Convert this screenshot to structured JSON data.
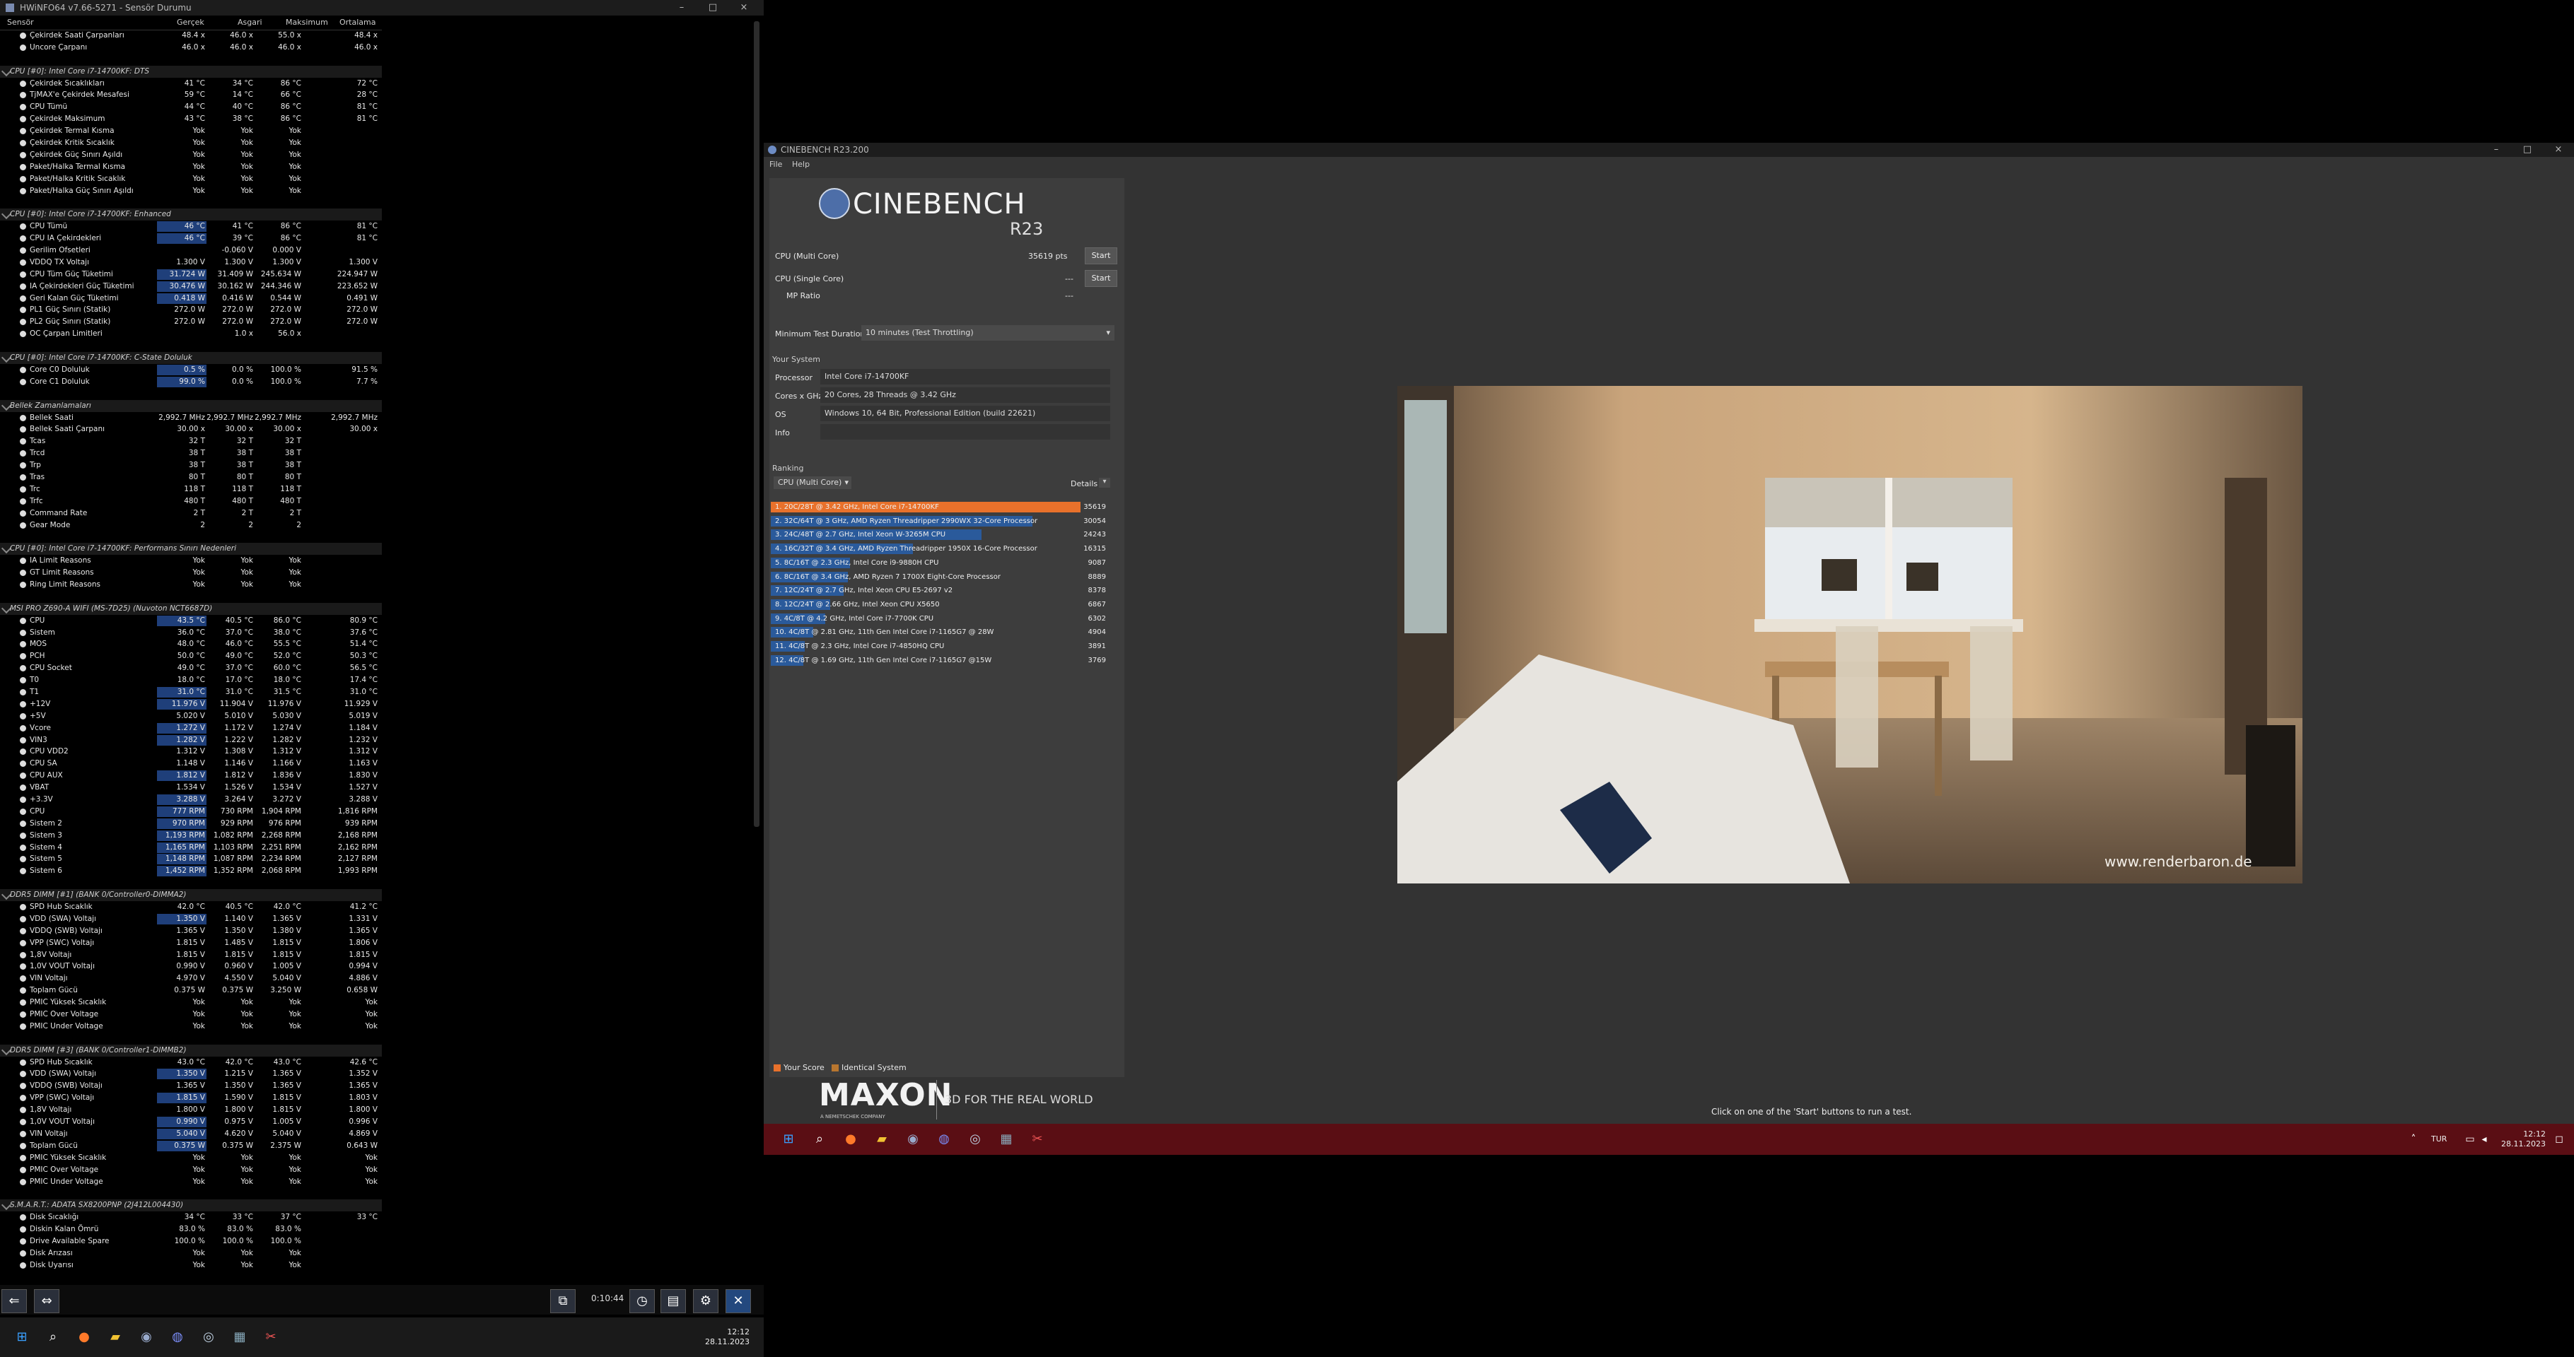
{
  "hw": {
    "title": "HWiNFO64 v7.66-5271 - Sensör Durumu",
    "columns": [
      "Sensör",
      "Gerçek",
      "Asgari",
      "Maksimum",
      "Ortalama"
    ],
    "timer": "0:10:44",
    "rows": [
      [
        "r",
        "Çekirdek Saati Çarpanları",
        "48.4 x",
        "46.0 x",
        "55.0 x",
        "48.4 x",
        ""
      ],
      [
        "r",
        "Uncore Çarpanı",
        "46.0 x",
        "46.0 x",
        "46.0 x",
        "46.0 x",
        ""
      ],
      [
        "b",
        "",
        "",
        "",
        "",
        "",
        ""
      ],
      [
        "g",
        "CPU [#0]: Intel Core i7-14700KF: DTS",
        "",
        "",
        "",
        "",
        ""
      ],
      [
        "r",
        "Çekirdek Sıcaklıkları",
        "41 °C",
        "34 °C",
        "86 °C",
        "72 °C",
        ""
      ],
      [
        "r",
        "TjMAX'e Çekirdek Mesafesi",
        "59 °C",
        "14 °C",
        "66 °C",
        "28 °C",
        ""
      ],
      [
        "r",
        "CPU Tümü",
        "44 °C",
        "40 °C",
        "86 °C",
        "81 °C",
        ""
      ],
      [
        "r",
        "Çekirdek Maksimum",
        "43 °C",
        "38 °C",
        "86 °C",
        "81 °C",
        ""
      ],
      [
        "r",
        "Çekirdek Termal Kısma",
        "Yok",
        "Yok",
        "Yok",
        "",
        ""
      ],
      [
        "r",
        "Çekirdek Kritik Sıcaklık",
        "Yok",
        "Yok",
        "Yok",
        "",
        ""
      ],
      [
        "r",
        "Çekirdek Güç Sınırı Aşıldı",
        "Yok",
        "Yok",
        "Yok",
        "",
        ""
      ],
      [
        "r",
        "Paket/Halka Termal Kısma",
        "Yok",
        "Yok",
        "Yok",
        "",
        ""
      ],
      [
        "r",
        "Paket/Halka Kritik Sıcaklık",
        "Yok",
        "Yok",
        "Yok",
        "",
        ""
      ],
      [
        "r",
        "Paket/Halka Güç Sınırı Aşıldı",
        "Yok",
        "Yok",
        "Yok",
        "",
        ""
      ],
      [
        "b",
        "",
        "",
        "",
        "",
        "",
        ""
      ],
      [
        "g",
        "CPU [#0]: Intel Core i7-14700KF: Enhanced",
        "",
        "",
        "",
        "",
        ""
      ],
      [
        "r",
        "CPU Tümü",
        "46 °C",
        "41 °C",
        "86 °C",
        "81 °C",
        "h"
      ],
      [
        "r",
        "CPU IA Çekirdekleri",
        "46 °C",
        "39 °C",
        "86 °C",
        "81 °C",
        "h"
      ],
      [
        "r",
        "Gerilim Ofsetleri",
        "",
        "-0.060 V",
        "0.000 V",
        "",
        ""
      ],
      [
        "r",
        "VDDQ TX Voltajı",
        "1.300 V",
        "1.300 V",
        "1.300 V",
        "1.300 V",
        ""
      ],
      [
        "r",
        "CPU Tüm Güç Tüketimi",
        "31.724 W",
        "31.409 W",
        "245.634 W",
        "224.947 W",
        "h"
      ],
      [
        "r",
        "IA Çekirdekleri Güç Tüketimi",
        "30.476 W",
        "30.162 W",
        "244.346 W",
        "223.652 W",
        "h"
      ],
      [
        "r",
        "Geri Kalan Güç Tüketimi",
        "0.418 W",
        "0.416 W",
        "0.544 W",
        "0.491 W",
        "h"
      ],
      [
        "r",
        "PL1 Güç Sınırı (Statik)",
        "272.0 W",
        "272.0 W",
        "272.0 W",
        "272.0 W",
        ""
      ],
      [
        "r",
        "PL2 Güç Sınırı (Statik)",
        "272.0 W",
        "272.0 W",
        "272.0 W",
        "272.0 W",
        ""
      ],
      [
        "r",
        "OC Çarpan Limitleri",
        "",
        "1.0 x",
        "56.0 x",
        "",
        ""
      ],
      [
        "b",
        "",
        "",
        "",
        "",
        "",
        ""
      ],
      [
        "g",
        "CPU [#0]: Intel Core i7-14700KF: C-State Doluluk",
        "",
        "",
        "",
        "",
        ""
      ],
      [
        "r",
        "Core C0 Doluluk",
        "0.5 %",
        "0.0 %",
        "100.0 %",
        "91.5 %",
        "h"
      ],
      [
        "r",
        "Core C1 Doluluk",
        "99.0 %",
        "0.0 %",
        "100.0 %",
        "7.7 %",
        "h"
      ],
      [
        "b",
        "",
        "",
        "",
        "",
        "",
        ""
      ],
      [
        "g",
        "Bellek Zamanlamaları",
        "",
        "",
        "",
        "",
        ""
      ],
      [
        "r",
        "Bellek Saati",
        "2,992.7 MHz",
        "2,992.7 MHz",
        "2,992.7 MHz",
        "2,992.7 MHz",
        ""
      ],
      [
        "r",
        "Bellek Saati Çarpanı",
        "30.00 x",
        "30.00 x",
        "30.00 x",
        "30.00 x",
        ""
      ],
      [
        "r",
        "Tcas",
        "32 T",
        "32 T",
        "32 T",
        "",
        ""
      ],
      [
        "r",
        "Trcd",
        "38 T",
        "38 T",
        "38 T",
        "",
        ""
      ],
      [
        "r",
        "Trp",
        "38 T",
        "38 T",
        "38 T",
        "",
        ""
      ],
      [
        "r",
        "Tras",
        "80 T",
        "80 T",
        "80 T",
        "",
        ""
      ],
      [
        "r",
        "Trc",
        "118 T",
        "118 T",
        "118 T",
        "",
        ""
      ],
      [
        "r",
        "Trfc",
        "480 T",
        "480 T",
        "480 T",
        "",
        ""
      ],
      [
        "r",
        "Command Rate",
        "2 T",
        "2 T",
        "2 T",
        "",
        ""
      ],
      [
        "r",
        "Gear Mode",
        "2",
        "2",
        "2",
        "",
        ""
      ],
      [
        "b",
        "",
        "",
        "",
        "",
        "",
        ""
      ],
      [
        "g",
        "CPU [#0]: Intel Core i7-14700KF: Performans Sınırı Nedenleri",
        "",
        "",
        "",
        "",
        ""
      ],
      [
        "r",
        "IA Limit Reasons",
        "Yok",
        "Yok",
        "Yok",
        "",
        ""
      ],
      [
        "r",
        "GT Limit Reasons",
        "Yok",
        "Yok",
        "Yok",
        "",
        ""
      ],
      [
        "r",
        "Ring Limit Reasons",
        "Yok",
        "Yok",
        "Yok",
        "",
        ""
      ],
      [
        "b",
        "",
        "",
        "",
        "",
        "",
        ""
      ],
      [
        "g",
        "MSI PRO Z690-A WIFI (MS-7D25) (Nuvoton NCT6687D)",
        "",
        "",
        "",
        "",
        ""
      ],
      [
        "r",
        "CPU",
        "43.5 °C",
        "40.5 °C",
        "86.0 °C",
        "80.9 °C",
        "h"
      ],
      [
        "r",
        "Sistem",
        "36.0 °C",
        "37.0 °C",
        "38.0 °C",
        "37.6 °C",
        ""
      ],
      [
        "r",
        "MOS",
        "48.0 °C",
        "46.0 °C",
        "55.5 °C",
        "51.4 °C",
        ""
      ],
      [
        "r",
        "PCH",
        "50.0 °C",
        "49.0 °C",
        "52.0 °C",
        "50.3 °C",
        ""
      ],
      [
        "r",
        "CPU Socket",
        "49.0 °C",
        "37.0 °C",
        "60.0 °C",
        "56.5 °C",
        ""
      ],
      [
        "r",
        "T0",
        "18.0 °C",
        "17.0 °C",
        "18.0 °C",
        "17.4 °C",
        ""
      ],
      [
        "r",
        "T1",
        "31.0 °C",
        "31.0 °C",
        "31.5 °C",
        "31.0 °C",
        "h"
      ],
      [
        "r",
        "+12V",
        "11.976 V",
        "11.904 V",
        "11.976 V",
        "11.929 V",
        "h"
      ],
      [
        "r",
        "+5V",
        "5.020 V",
        "5.010 V",
        "5.030 V",
        "5.019 V",
        ""
      ],
      [
        "r",
        "Vcore",
        "1.272 V",
        "1.172 V",
        "1.274 V",
        "1.184 V",
        "h"
      ],
      [
        "r",
        "VIN3",
        "1.282 V",
        "1.222 V",
        "1.282 V",
        "1.232 V",
        "h"
      ],
      [
        "r",
        "CPU VDD2",
        "1.312 V",
        "1.308 V",
        "1.312 V",
        "1.312 V",
        ""
      ],
      [
        "r",
        "CPU SA",
        "1.148 V",
        "1.146 V",
        "1.166 V",
        "1.163 V",
        ""
      ],
      [
        "r",
        "CPU AUX",
        "1.812 V",
        "1.812 V",
        "1.836 V",
        "1.830 V",
        "h"
      ],
      [
        "r",
        "VBAT",
        "1.534 V",
        "1.526 V",
        "1.534 V",
        "1.527 V",
        ""
      ],
      [
        "r",
        "+3.3V",
        "3.288 V",
        "3.264 V",
        "3.272 V",
        "3.288 V",
        "h"
      ],
      [
        "r",
        "CPU",
        "777 RPM",
        "730 RPM",
        "1,904 RPM",
        "1,816 RPM",
        "h"
      ],
      [
        "r",
        "Sistem 2",
        "970 RPM",
        "929 RPM",
        "976 RPM",
        "939 RPM",
        "h"
      ],
      [
        "r",
        "Sistem 3",
        "1,193 RPM",
        "1,082 RPM",
        "2,268 RPM",
        "2,168 RPM",
        "h"
      ],
      [
        "r",
        "Sistem 4",
        "1,165 RPM",
        "1,103 RPM",
        "2,251 RPM",
        "2,162 RPM",
        "h"
      ],
      [
        "r",
        "Sistem 5",
        "1,148 RPM",
        "1,087 RPM",
        "2,234 RPM",
        "2,127 RPM",
        "h"
      ],
      [
        "r",
        "Sistem 6",
        "1,452 RPM",
        "1,352 RPM",
        "2,068 RPM",
        "1,993 RPM",
        "h"
      ],
      [
        "b",
        "",
        "",
        "",
        "",
        "",
        ""
      ],
      [
        "g",
        "DDR5 DIMM [#1] (BANK 0/Controller0-DIMMA2)",
        "",
        "",
        "",
        "",
        ""
      ],
      [
        "r",
        "SPD Hub Sıcaklık",
        "42.0 °C",
        "40.5 °C",
        "42.0 °C",
        "41.2 °C",
        ""
      ],
      [
        "r",
        "VDD (SWA) Voltajı",
        "1.350 V",
        "1.140 V",
        "1.365 V",
        "1.331 V",
        "h"
      ],
      [
        "r",
        "VDDQ (SWB) Voltajı",
        "1.365 V",
        "1.350 V",
        "1.380 V",
        "1.365 V",
        ""
      ],
      [
        "r",
        "VPP (SWC) Voltajı",
        "1.815 V",
        "1.485 V",
        "1.815 V",
        "1.806 V",
        ""
      ],
      [
        "r",
        "1,8V Voltajı",
        "1.815 V",
        "1.815 V",
        "1.815 V",
        "1.815 V",
        ""
      ],
      [
        "r",
        "1,0V VOUT Voltajı",
        "0.990 V",
        "0.960 V",
        "1.005 V",
        "0.994 V",
        ""
      ],
      [
        "r",
        "VIN Voltajı",
        "4.970 V",
        "4.550 V",
        "5.040 V",
        "4.886 V",
        ""
      ],
      [
        "r",
        "Toplam Gücü",
        "0.375 W",
        "0.375 W",
        "3.250 W",
        "0.658 W",
        ""
      ],
      [
        "r",
        "PMIC Yüksek Sıcaklık",
        "Yok",
        "Yok",
        "Yok",
        "Yok",
        ""
      ],
      [
        "r",
        "PMIC Over Voltage",
        "Yok",
        "Yok",
        "Yok",
        "Yok",
        ""
      ],
      [
        "r",
        "PMIC Under Voltage",
        "Yok",
        "Yok",
        "Yok",
        "Yok",
        ""
      ],
      [
        "b",
        "",
        "",
        "",
        "",
        "",
        ""
      ],
      [
        "g",
        "DDR5 DIMM [#3] (BANK 0/Controller1-DIMMB2)",
        "",
        "",
        "",
        "",
        ""
      ],
      [
        "r",
        "SPD Hub Sıcaklık",
        "43.0 °C",
        "42.0 °C",
        "43.0 °C",
        "42.6 °C",
        ""
      ],
      [
        "r",
        "VDD (SWA) Voltajı",
        "1.350 V",
        "1.215 V",
        "1.365 V",
        "1.352 V",
        "h"
      ],
      [
        "r",
        "VDDQ (SWB) Voltajı",
        "1.365 V",
        "1.350 V",
        "1.365 V",
        "1.365 V",
        ""
      ],
      [
        "r",
        "VPP (SWC) Voltajı",
        "1.815 V",
        "1.590 V",
        "1.815 V",
        "1.803 V",
        "h"
      ],
      [
        "r",
        "1,8V Voltajı",
        "1.800 V",
        "1.800 V",
        "1.815 V",
        "1.800 V",
        ""
      ],
      [
        "r",
        "1,0V VOUT Voltajı",
        "0.990 V",
        "0.975 V",
        "1.005 V",
        "0.996 V",
        "h"
      ],
      [
        "r",
        "VIN Voltajı",
        "5.040 V",
        "4.620 V",
        "5.040 V",
        "4.869 V",
        "h"
      ],
      [
        "r",
        "Toplam Gücü",
        "0.375 W",
        "0.375 W",
        "2.375 W",
        "0.643 W",
        "h"
      ],
      [
        "r",
        "PMIC Yüksek Sıcaklık",
        "Yok",
        "Yok",
        "Yok",
        "Yok",
        ""
      ],
      [
        "r",
        "PMIC Over Voltage",
        "Yok",
        "Yok",
        "Yok",
        "Yok",
        ""
      ],
      [
        "r",
        "PMIC Under Voltage",
        "Yok",
        "Yok",
        "Yok",
        "Yok",
        ""
      ],
      [
        "b",
        "",
        "",
        "",
        "",
        "",
        ""
      ],
      [
        "g",
        "S.M.A.R.T.: ADATA SX8200PNP (2J412L004430)",
        "",
        "",
        "",
        "",
        ""
      ],
      [
        "r",
        "Disk Sıcaklığı",
        "34 °C",
        "33 °C",
        "37 °C",
        "33 °C",
        ""
      ],
      [
        "r",
        "Diskin Kalan Ömrü",
        "83.0 %",
        "83.0 %",
        "83.0 %",
        "",
        ""
      ],
      [
        "r",
        "Drive Available Spare",
        "100.0 %",
        "100.0 %",
        "100.0 %",
        "",
        ""
      ],
      [
        "r",
        "Disk Arızası",
        "Yok",
        "Yok",
        "Yok",
        "",
        ""
      ],
      [
        "r",
        "Disk Uyarısı",
        "Yok",
        "Yok",
        "Yok",
        "",
        ""
      ]
    ]
  },
  "cb": {
    "title": "CINEBENCH R23.200",
    "menu": [
      "File",
      "Help"
    ],
    "logo_name": "CINEBENCH",
    "logo_sub": "R23",
    "multi_label": "CPU (Multi Core)",
    "multi_score": "35619 pts",
    "single_label": "CPU (Single Core)",
    "single_score": "---",
    "mp_label": "MP Ratio",
    "mp_value": "---",
    "start": "Start",
    "min_dur_label": "Minimum Test Duration",
    "min_dur_value": "10 minutes (Test Throttling)",
    "your_system": "Your System",
    "sys": [
      [
        "Processor",
        "Intel Core i7-14700KF"
      ],
      [
        "Cores x GHz",
        "20 Cores, 28 Threads @ 3.42 GHz"
      ],
      [
        "OS",
        "Windows 10, 64 Bit, Professional Edition (build 22621)"
      ],
      [
        "Info",
        ""
      ]
    ],
    "ranking": "Ranking",
    "rank_select": "CPU (Multi Core)",
    "details": "Details",
    "ranks": [
      [
        "1. 20C/28T @ 3.42 GHz, Intel Core i7-14700KF",
        "35619"
      ],
      [
        "2. 32C/64T @ 3 GHz, AMD Ryzen Threadripper 2990WX 32-Core Processor",
        "30054"
      ],
      [
        "3. 24C/48T @ 2.7 GHz, Intel Xeon W-3265M CPU",
        "24243"
      ],
      [
        "4. 16C/32T @ 3.4 GHz, AMD Ryzen Threadripper 1950X 16-Core Processor",
        "16315"
      ],
      [
        "5. 8C/16T @ 2.3 GHz, Intel Core i9-9880H CPU",
        "9087"
      ],
      [
        "6. 8C/16T @ 3.4 GHz, AMD Ryzen 7 1700X Eight-Core Processor",
        "8889"
      ],
      [
        "7. 12C/24T @ 2.7 GHz, Intel Xeon CPU E5-2697 v2",
        "8378"
      ],
      [
        "8. 12C/24T @ 2.66 GHz, Intel Xeon CPU X5650",
        "6867"
      ],
      [
        "9. 4C/8T @ 4.2 GHz, Intel Core i7-7700K CPU",
        "6302"
      ],
      [
        "10. 4C/8T @ 2.81 GHz, 11th Gen Intel Core i7-1165G7 @ 28W",
        "4904"
      ],
      [
        "11. 4C/8T @ 2.3 GHz, Intel Core i7-4850HQ CPU",
        "3891"
      ],
      [
        "12. 4C/8T @ 1.69 GHz, 11th Gen Intel Core i7-1165G7 @15W",
        "3769"
      ]
    ],
    "legend_your": "Your Score",
    "legend_identical": "Identical System",
    "maxon": "MAXON",
    "maxon_sub": "A NEMETSCHEK COMPANY",
    "tagline": "3D FOR THE REAL WORLD",
    "watermark": "www.renderbaron.de",
    "status": "Click on one of the 'Start' buttons to run a test."
  },
  "tb_left": {
    "time": "12:12",
    "date": "28.11.2023"
  },
  "tb_right": {
    "lang": "TUR",
    "time": "12:12",
    "date": "28.11.2023"
  },
  "colors": {
    "accent_orange": "#e8712b",
    "rank_blue": "#2a5a9b",
    "taskbar_red": "#5a0e14"
  }
}
